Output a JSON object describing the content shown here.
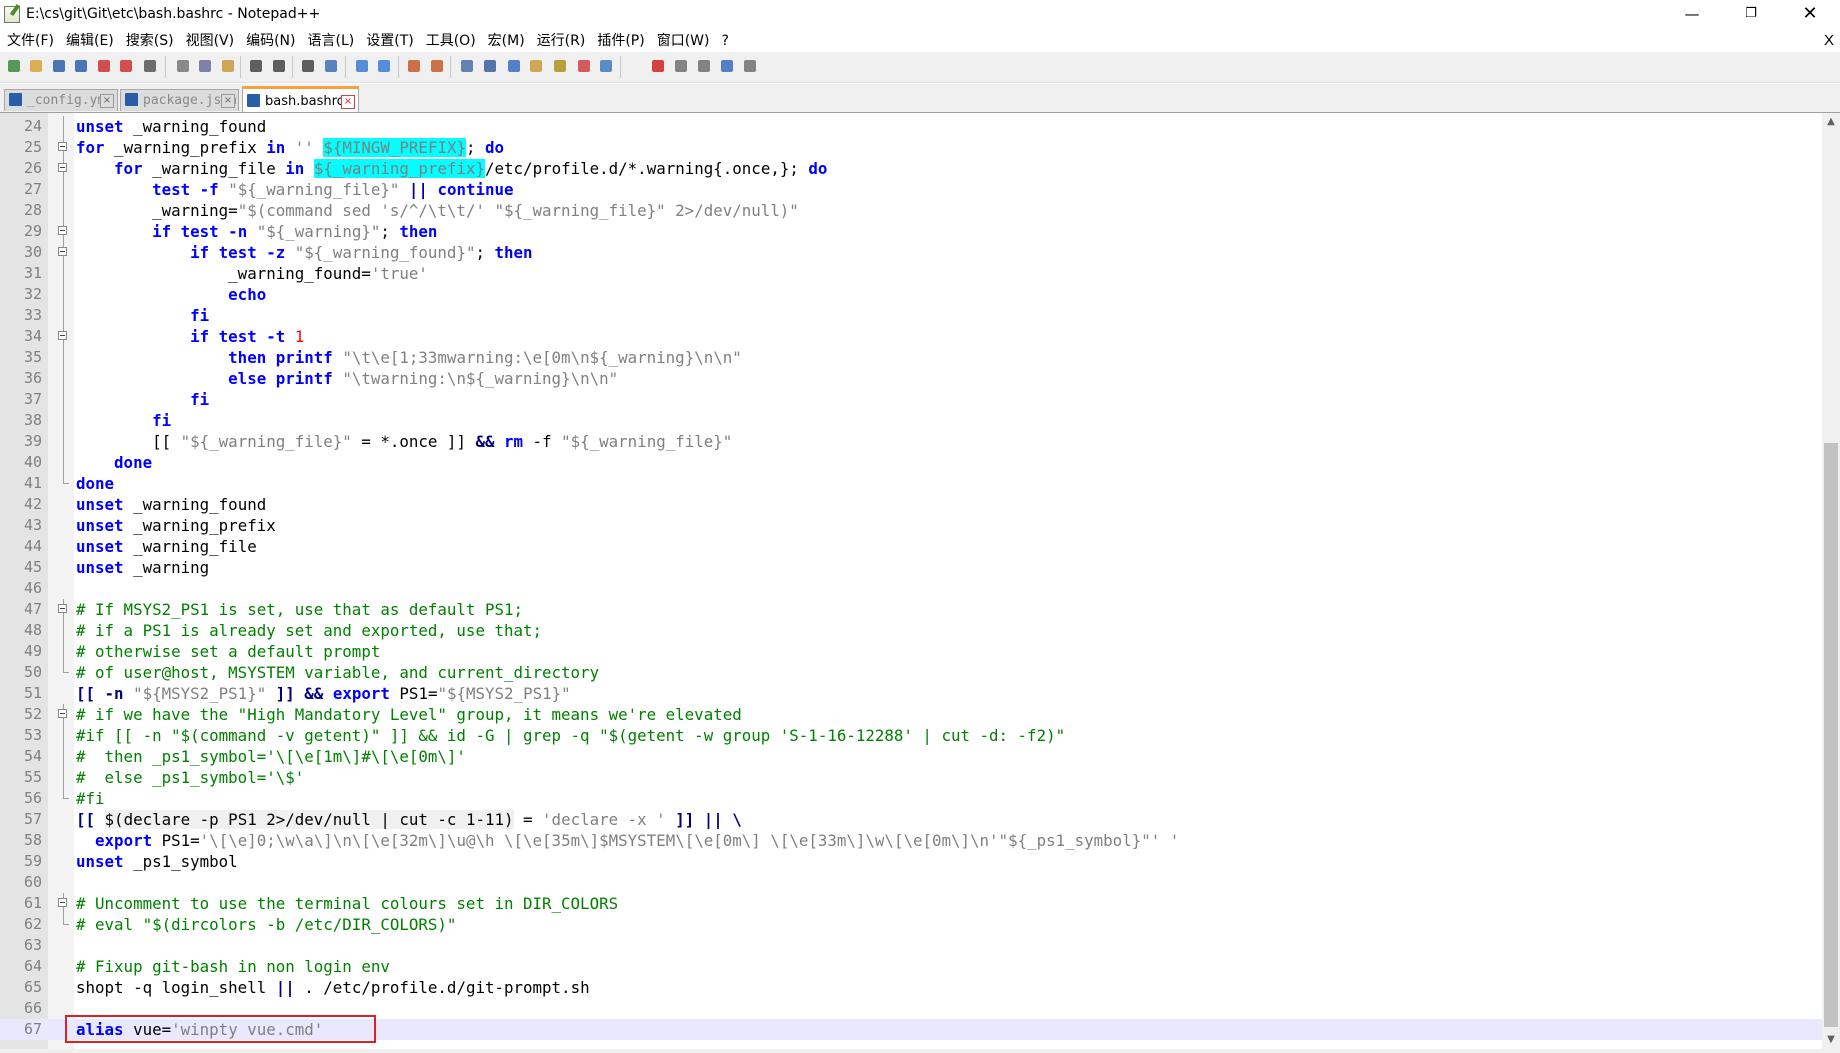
{
  "window": {
    "title": "E:\\cs\\git\\Git\\etc\\bash.bashrc - Notepad++",
    "minimize": "—",
    "maximize": "❐",
    "close": "✕"
  },
  "menu": {
    "items": [
      "文件(F)",
      "编辑(E)",
      "搜索(S)",
      "视图(V)",
      "编码(N)",
      "语言(L)",
      "设置(T)",
      "工具(O)",
      "宏(M)",
      "运行(R)",
      "插件(P)",
      "窗口(W)",
      "?"
    ],
    "doc_close": "X"
  },
  "toolbar": {
    "icons": [
      "new-file-icon",
      "open-file-icon",
      "save-icon",
      "save-all-icon",
      "close-icon",
      "close-all-icon",
      "print-icon",
      "cut-icon",
      "copy-icon",
      "paste-icon",
      "undo-icon",
      "redo-icon",
      "find-icon",
      "replace-icon",
      "zoom-in-icon",
      "zoom-out-icon",
      "sync-v-icon",
      "sync-h-icon",
      "word-wrap-icon",
      "show-all-chars-icon",
      "indent-guide-icon",
      "function-list-icon",
      "doc-map-icon",
      "folder-workspace-icon",
      "monitoring-icon",
      "record-macro-icon",
      "stop-macro-icon",
      "play-macro-icon",
      "run-macro-multiple-icon",
      "save-macro-icon"
    ],
    "icon_colors": [
      "#3c8b3c",
      "#d8a23a",
      "#2b5fa8",
      "#2b5fa8",
      "#c33",
      "#c33",
      "#555",
      "#777",
      "#6b6b9a",
      "#c89a3c",
      "#444",
      "#444",
      "#444",
      "#3c6fb6",
      "#3a7bd5",
      "#3a7bd5",
      "#c45a2a",
      "#c45a2a",
      "#4a6ea8",
      "#3a5ea0",
      "#3a6cc0",
      "#c89a3c",
      "#b09020",
      "#d04040",
      "#3d7cc0",
      "#d02020",
      "#707070",
      "#707070",
      "#3a6cc0",
      "#707070"
    ]
  },
  "tabs": [
    {
      "label": "_config.yml",
      "active": false
    },
    {
      "label": "package.json",
      "active": false
    },
    {
      "label": "bash.bashrc",
      "active": true
    }
  ],
  "editor": {
    "lines": [
      {
        "n": "24",
        "fold": "line"
      },
      {
        "n": "25",
        "fold": "box"
      },
      {
        "n": "26",
        "fold": "box"
      },
      {
        "n": "27",
        "fold": "line"
      },
      {
        "n": "28",
        "fold": "line"
      },
      {
        "n": "29",
        "fold": "box"
      },
      {
        "n": "30",
        "fold": "box"
      },
      {
        "n": "31",
        "fold": "line"
      },
      {
        "n": "32",
        "fold": "line"
      },
      {
        "n": "33",
        "fold": "line"
      },
      {
        "n": "34",
        "fold": "box"
      },
      {
        "n": "35",
        "fold": "line"
      },
      {
        "n": "36",
        "fold": "line"
      },
      {
        "n": "37",
        "fold": "line"
      },
      {
        "n": "38",
        "fold": "line"
      },
      {
        "n": "39",
        "fold": "line"
      },
      {
        "n": "40",
        "fold": "line"
      },
      {
        "n": "41",
        "fold": "end"
      },
      {
        "n": "42",
        "fold": ""
      },
      {
        "n": "43",
        "fold": ""
      },
      {
        "n": "44",
        "fold": ""
      },
      {
        "n": "45",
        "fold": ""
      },
      {
        "n": "46",
        "fold": ""
      },
      {
        "n": "47",
        "fold": "box"
      },
      {
        "n": "48",
        "fold": "line"
      },
      {
        "n": "49",
        "fold": "line"
      },
      {
        "n": "50",
        "fold": "end"
      },
      {
        "n": "51",
        "fold": ""
      },
      {
        "n": "52",
        "fold": "box"
      },
      {
        "n": "53",
        "fold": "line"
      },
      {
        "n": "54",
        "fold": "line"
      },
      {
        "n": "55",
        "fold": "line"
      },
      {
        "n": "56",
        "fold": "end"
      },
      {
        "n": "57",
        "fold": ""
      },
      {
        "n": "58",
        "fold": ""
      },
      {
        "n": "59",
        "fold": ""
      },
      {
        "n": "60",
        "fold": ""
      },
      {
        "n": "61",
        "fold": "box"
      },
      {
        "n": "62",
        "fold": "end"
      },
      {
        "n": "63",
        "fold": ""
      },
      {
        "n": "64",
        "fold": ""
      },
      {
        "n": "65",
        "fold": ""
      },
      {
        "n": "66",
        "fold": ""
      },
      {
        "n": "67",
        "fold": "",
        "current": true
      }
    ],
    "code": [
      [
        [
          "kw",
          "unset"
        ],
        [
          "t",
          " _warning_found"
        ]
      ],
      [
        [
          "kw",
          "for"
        ],
        [
          "t",
          " _warning_prefix "
        ],
        [
          "kw",
          "in"
        ],
        [
          "t",
          " "
        ],
        [
          "str",
          "''"
        ],
        [
          "t",
          " "
        ],
        [
          "var",
          "${MINGW_PREFIX}"
        ],
        [
          "t",
          "; "
        ],
        [
          "kw",
          "do"
        ]
      ],
      [
        [
          "t",
          "    "
        ],
        [
          "kw",
          "for"
        ],
        [
          "t",
          " _warning_file "
        ],
        [
          "kw",
          "in"
        ],
        [
          "t",
          " "
        ],
        [
          "var",
          "${_warning_prefix}"
        ],
        [
          "t",
          "/etc/profile.d/*.warning{.once,}; "
        ],
        [
          "kw",
          "do"
        ]
      ],
      [
        [
          "t",
          "        "
        ],
        [
          "kw",
          "test -f"
        ],
        [
          "t",
          " "
        ],
        [
          "str",
          "\"${_warning_file}\""
        ],
        [
          "t",
          " "
        ],
        [
          "op",
          "||"
        ],
        [
          "t",
          " "
        ],
        [
          "kw",
          "continue"
        ]
      ],
      [
        [
          "t",
          "        _warning="
        ],
        [
          "str",
          "\"$(command sed 's/^/\\t\\t/' \"${_warning_file}\" 2>/dev/null)\""
        ]
      ],
      [
        [
          "t",
          "        "
        ],
        [
          "kw",
          "if test -n"
        ],
        [
          "t",
          " "
        ],
        [
          "str",
          "\"${_warning}\""
        ],
        [
          "t",
          "; "
        ],
        [
          "kw",
          "then"
        ]
      ],
      [
        [
          "t",
          "            "
        ],
        [
          "kw",
          "if test -z"
        ],
        [
          "t",
          " "
        ],
        [
          "str",
          "\"${_warning_found}\""
        ],
        [
          "t",
          "; "
        ],
        [
          "kw",
          "then"
        ]
      ],
      [
        [
          "t",
          "                _warning_found="
        ],
        [
          "str",
          "'true'"
        ]
      ],
      [
        [
          "t",
          "                "
        ],
        [
          "kw",
          "echo"
        ]
      ],
      [
        [
          "t",
          "            "
        ],
        [
          "kw",
          "fi"
        ]
      ],
      [
        [
          "t",
          "            "
        ],
        [
          "kw",
          "if test -t"
        ],
        [
          "t",
          " "
        ],
        [
          "num",
          "1"
        ]
      ],
      [
        [
          "t",
          "                "
        ],
        [
          "kw",
          "then printf"
        ],
        [
          "t",
          " "
        ],
        [
          "str",
          "\"\\t\\e[1;33mwarning:\\e[0m\\n${_warning}\\n\\n\""
        ]
      ],
      [
        [
          "t",
          "                "
        ],
        [
          "kw",
          "else printf"
        ],
        [
          "t",
          " "
        ],
        [
          "str",
          "\"\\twarning:\\n${_warning}\\n\\n\""
        ]
      ],
      [
        [
          "t",
          "            "
        ],
        [
          "kw",
          "fi"
        ]
      ],
      [
        [
          "t",
          "        "
        ],
        [
          "kw",
          "fi"
        ]
      ],
      [
        [
          "t",
          "        [[ "
        ],
        [
          "str",
          "\"${_warning_file}\""
        ],
        [
          "t",
          " = *.once ]] "
        ],
        [
          "op",
          "&&"
        ],
        [
          "t",
          " "
        ],
        [
          "kw",
          "rm"
        ],
        [
          "t",
          " -f "
        ],
        [
          "str",
          "\"${_warning_file}\""
        ]
      ],
      [
        [
          "t",
          "    "
        ],
        [
          "kw",
          "done"
        ]
      ],
      [
        [
          "kw",
          "done"
        ]
      ],
      [
        [
          "kw",
          "unset"
        ],
        [
          "t",
          " _warning_found"
        ]
      ],
      [
        [
          "kw",
          "unset"
        ],
        [
          "t",
          " _warning_prefix"
        ]
      ],
      [
        [
          "kw",
          "unset"
        ],
        [
          "t",
          " _warning_file"
        ]
      ],
      [
        [
          "kw",
          "unset"
        ],
        [
          "t",
          " _warning"
        ]
      ],
      [
        [
          "t",
          ""
        ]
      ],
      [
        [
          "cm",
          "# If MSYS2_PS1 is set, use that as default PS1;"
        ]
      ],
      [
        [
          "cm",
          "# if a PS1 is already set and exported, use that;"
        ]
      ],
      [
        [
          "cm",
          "# otherwise set a default prompt"
        ]
      ],
      [
        [
          "cm",
          "# of user@host, MSYSTEM variable, and current_directory"
        ]
      ],
      [
        [
          "op",
          "[[ -n"
        ],
        [
          "t",
          " "
        ],
        [
          "str",
          "\"${MSYS2_PS1}\""
        ],
        [
          "t",
          " "
        ],
        [
          "op",
          "]] &&"
        ],
        [
          "t",
          " "
        ],
        [
          "kw",
          "export"
        ],
        [
          "t",
          " PS1="
        ],
        [
          "str",
          "\"${MSYS2_PS1}\""
        ]
      ],
      [
        [
          "cm",
          "# if we have the \"High Mandatory Level\" group, it means we're elevated"
        ]
      ],
      [
        [
          "cm",
          "#if [[ -n \"$(command -v getent)\" ]] && id -G | grep -q \"$(getent -w group 'S-1-16-12288' | cut -d: -f2)\""
        ]
      ],
      [
        [
          "cm",
          "#  then _ps1_symbol='\\[\\e[1m\\]#\\[\\e[0m\\]'"
        ]
      ],
      [
        [
          "cm",
          "#  else _ps1_symbol='\\$'"
        ]
      ],
      [
        [
          "cm",
          "#fi"
        ]
      ],
      [
        [
          "op",
          "[[ "
        ],
        [
          "bq",
          "$(declare -p PS1 2>/dev/null | cut -c 1-11)"
        ],
        [
          "t",
          " = "
        ],
        [
          "str",
          "'declare -x '"
        ],
        [
          "t",
          " "
        ],
        [
          "op",
          "]] || \\"
        ]
      ],
      [
        [
          "t",
          "  "
        ],
        [
          "kw",
          "export"
        ],
        [
          "t",
          " PS1="
        ],
        [
          "str",
          "'\\[\\e]0;\\w\\a\\]\\n\\[\\e[32m\\]\\u@\\h \\[\\e[35m\\]$MSYSTEM\\[\\e[0m\\] \\[\\e[33m\\]\\w\\[\\e[0m\\]\\n'\"${_ps1_symbol}\"' '"
        ]
      ],
      [
        [
          "kw",
          "unset"
        ],
        [
          "t",
          " _ps1_symbol"
        ]
      ],
      [
        [
          "t",
          ""
        ]
      ],
      [
        [
          "cm",
          "# Uncomment to use the terminal colours set in DIR_COLORS"
        ]
      ],
      [
        [
          "cm",
          "# eval \"$(dircolors -b /etc/DIR_COLORS)\""
        ]
      ],
      [
        [
          "t",
          ""
        ]
      ],
      [
        [
          "cm",
          "# Fixup git-bash in non login env"
        ]
      ],
      [
        [
          "t",
          "shopt -q login_shell "
        ],
        [
          "op",
          "||"
        ],
        [
          "t",
          " . /etc/profile.d/git-prompt.sh"
        ]
      ],
      [
        [
          "t",
          ""
        ]
      ],
      [
        [
          "kw",
          "alias"
        ],
        [
          "t",
          " vue="
        ],
        [
          "str",
          "'winpty vue.cmd'"
        ]
      ]
    ]
  },
  "scrollbar": {
    "up": "▲",
    "down": "▼"
  }
}
